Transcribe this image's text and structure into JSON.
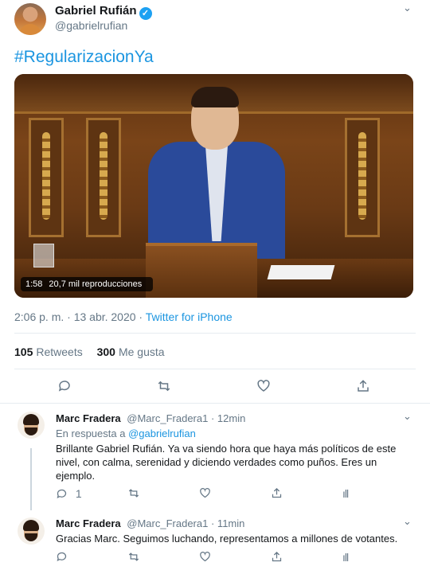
{
  "main_tweet": {
    "author_name": "Gabriel Rufián",
    "verified_glyph": "✓",
    "handle": "@gabrielrufian",
    "hashtag": "#RegularizacionYa",
    "video": {
      "duration": "1:58",
      "views": "20,7 mil reproducciones"
    },
    "timestamp": "2:06 p. m. · 13 abr. 2020 ·",
    "source": "Twitter for iPhone",
    "retweets_count": "105",
    "retweets_label": "Retweets",
    "likes_count": "300",
    "likes_label": "Me gusta",
    "icons": [
      "reply-icon",
      "retweet-icon",
      "like-icon",
      "share-icon"
    ]
  },
  "replies": [
    {
      "author_name": "Marc Fradera",
      "handle": "@Marc_Fradera1",
      "time": "· 12min",
      "reply_to_prefix": "En respuesta a",
      "reply_to_mention": "@gabrielrufian",
      "text": "Brillante Gabriel Rufián. Ya va siendo hora que haya más políticos de este nivel, con calma, serenidad y diciendo verdades como puños. Eres un ejemplo.",
      "reply_count": "1"
    },
    {
      "author_name": "Marc Fradera",
      "handle": "@Marc_Fradera1",
      "time": "· 11min",
      "text": "Gracias Marc. Seguimos luchando, representamos a millones de votantes."
    }
  ],
  "glyphs": {
    "chevron": "⌄",
    "reply": "💬",
    "retweet": "⇄",
    "like": "♡",
    "share": "⇧",
    "stats": "ıll"
  },
  "colors": {
    "accent": "#1b95e0",
    "secondary_text": "#657786",
    "border": "#e6ecf0"
  }
}
